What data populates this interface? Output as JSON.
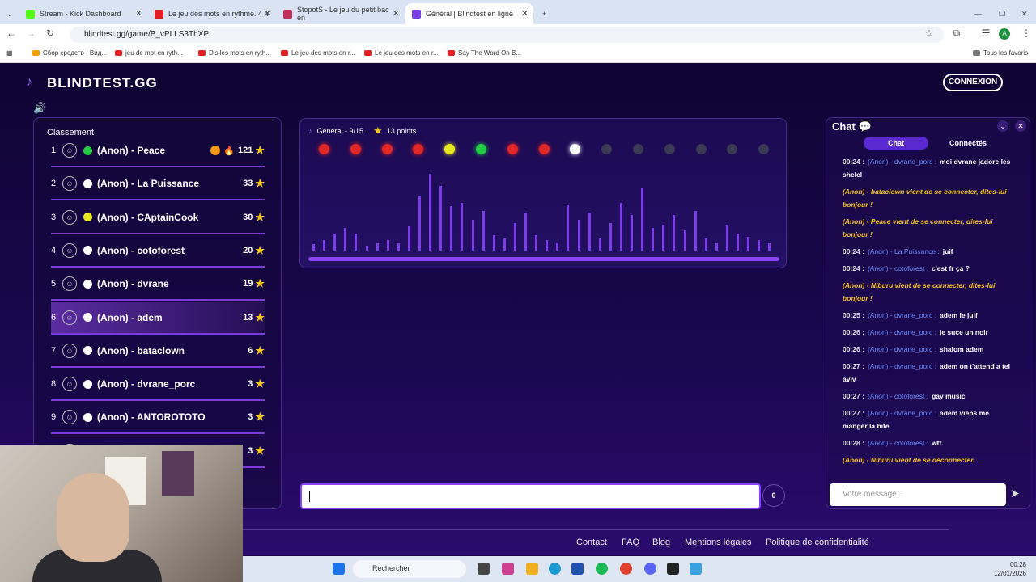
{
  "browser": {
    "tabs": [
      {
        "title": "Stream - Kick Dashboard",
        "color": "#53fc18"
      },
      {
        "title": "Le jeu des mots en rythme. 4 n",
        "color": "#e02020"
      },
      {
        "title": "StopotS - Le jeu du petit bac en",
        "color": "#c0305a"
      },
      {
        "title": "Général | Blindtest en ligne",
        "color": "#7b3de8"
      }
    ],
    "url": "blindtest.gg/game/B_vPLLS3ThXP",
    "bookmarks": [
      "Сбор средств - Вид...",
      "jeu de mot en ryth...",
      "Dis les mots en ryth...",
      "Le jeu des mots en r...",
      "Le jeu des mots en r...",
      "Say The Word On B..."
    ],
    "all_bookmarks": "Tous les favoris",
    "avatar_letter": "A"
  },
  "header": {
    "logo": "BLINDTEST.GG",
    "login": "CONNEXION"
  },
  "ranking": {
    "title": "Classement",
    "players": [
      {
        "rank": "1",
        "name": "(Anon) - Peace",
        "score": "121",
        "dot": "#22cc44",
        "streak": true
      },
      {
        "rank": "2",
        "name": "(Anon) - La Puissance",
        "score": "33",
        "dot": "#ffffff"
      },
      {
        "rank": "3",
        "name": "(Anon) - CAptainCook",
        "score": "30",
        "dot": "#e8e820"
      },
      {
        "rank": "4",
        "name": "(Anon) - cotoforest",
        "score": "20",
        "dot": "#ffffff"
      },
      {
        "rank": "5",
        "name": "(Anon) - dvrane",
        "score": "19",
        "dot": "#ffffff"
      },
      {
        "rank": "6",
        "name": "(Anon) - adem",
        "score": "13",
        "dot": "#ffffff",
        "highlight": true
      },
      {
        "rank": "7",
        "name": "(Anon) - bataclown",
        "score": "6",
        "dot": "#ffffff"
      },
      {
        "rank": "8",
        "name": "(Anon) - dvrane_porc",
        "score": "3",
        "dot": "#ffffff"
      },
      {
        "rank": "9",
        "name": "(Anon) - ANTOROTOTO",
        "score": "3",
        "dot": "#ffffff"
      },
      {
        "rank": "",
        "name": "",
        "score": "3",
        "dot": "#ffffff"
      }
    ]
  },
  "player": {
    "round": "Général - 9/15",
    "points": "13 points",
    "rounds": [
      "#e02828",
      "#e02828",
      "#e02828",
      "#e02828",
      "#e8e820",
      "#22cc44",
      "#e02828",
      "#e02828",
      "#ffffff",
      "#3a3a55",
      "#3a3a55",
      "#3a3a55",
      "#3a3a55",
      "#3a3a55",
      "#3a3a55"
    ],
    "levels": [
      0.08,
      0.14,
      0.22,
      0.3,
      0.22,
      0.06,
      0.1,
      0.14,
      0.1,
      0.32,
      0.72,
      1.0,
      0.84,
      0.58,
      0.62,
      0.4,
      0.52,
      0.2,
      0.16,
      0.36,
      0.5,
      0.2,
      0.14,
      0.1,
      0.6,
      0.4,
      0.5,
      0.16,
      0.36,
      0.62,
      0.46,
      0.82,
      0.3,
      0.34,
      0.46,
      0.26,
      0.52,
      0.16,
      0.1,
      0.34,
      0.22,
      0.18,
      0.14,
      0.1
    ]
  },
  "answer": {
    "counter": "0"
  },
  "chat": {
    "title": "Chat",
    "tab_chat": "Chat",
    "tab_connected": "Connectés",
    "messages": [
      {
        "time": "00:24 :",
        "user": "(Anon) - dvrane_porc :",
        "text": "moi dvrane jadore les shelel"
      },
      {
        "system": "(Anon) - bataclown vient de se connecter, dites-lui bonjour !"
      },
      {
        "system": "(Anon) - Peace vient de se connecter, dites-lui bonjour !"
      },
      {
        "time": "00:24 :",
        "user": "(Anon) - La Puissance :",
        "text": "juif"
      },
      {
        "time": "00:24 :",
        "user": "(Anon) - cotoforest :",
        "text": "c'est fr ça ?"
      },
      {
        "system": "(Anon) - Niburu vient de se connecter, dites-lui bonjour !"
      },
      {
        "time": "00:25 :",
        "user": "(Anon) - dvrane_porc :",
        "text": "adem le juif"
      },
      {
        "time": "00:26 :",
        "user": "(Anon) - dvrane_porc :",
        "text": "je suce un noir"
      },
      {
        "time": "00:26 :",
        "user": "(Anon) - dvrane_porc :",
        "text": "shalom adem"
      },
      {
        "time": "00:27 :",
        "user": "(Anon) - dvrane_porc :",
        "text": "adem on t'attend a tel aviv"
      },
      {
        "time": "00:27 :",
        "user": "(Anon) - cotoforest :",
        "text": "gay music"
      },
      {
        "time": "00:27 :",
        "user": "(Anon) - dvrane_porc :",
        "text": "adem viens me manger la bite"
      },
      {
        "time": "00:28 :",
        "user": "(Anon) - cotoforest :",
        "text": "wtf"
      },
      {
        "system": "(Anon) - Niburu vient de se déconnecter."
      }
    ],
    "placeholder": "Votre message..."
  },
  "footer": {
    "links": [
      "Contact",
      "FAQ",
      "Blog",
      "Mentions légales",
      "Politique de confidentialité"
    ]
  },
  "taskbar": {
    "search": "Rechercher",
    "time": "00:28",
    "date": "12/01/2026"
  }
}
